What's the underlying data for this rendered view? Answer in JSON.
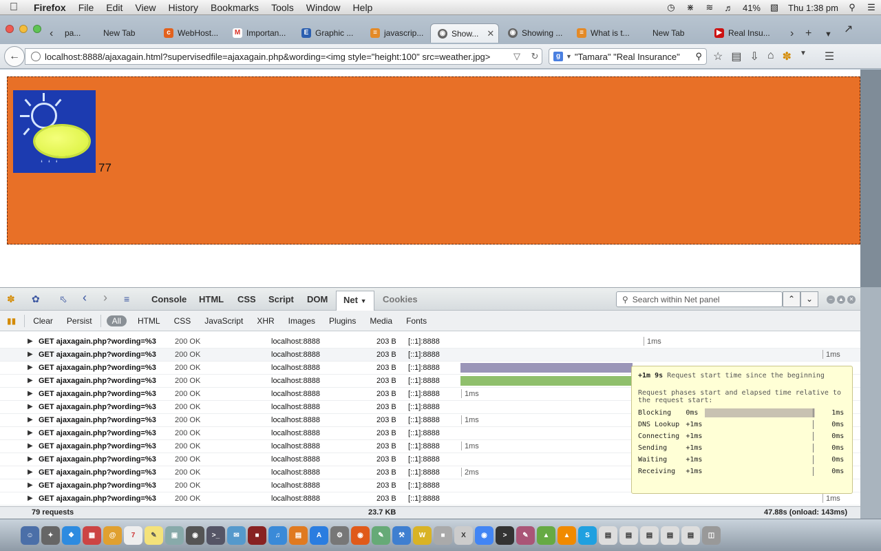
{
  "menubar": {
    "app_name": "Firefox",
    "menus": [
      "File",
      "Edit",
      "View",
      "History",
      "Bookmarks",
      "Tools",
      "Window",
      "Help"
    ],
    "battery": "41%",
    "clock": "Thu 1:38 pm"
  },
  "tabs": [
    {
      "label": "pa...",
      "icon": "generic-icon",
      "color": "#888888"
    },
    {
      "label": "New Tab",
      "icon": "none",
      "color": "#cccccc"
    },
    {
      "label": "WebHost...",
      "icon": "cpanel-icon",
      "color": "#e2611d"
    },
    {
      "label": "Importan...",
      "icon": "gmail-icon",
      "color": "#d93025"
    },
    {
      "label": "Graphic ...",
      "icon": "e-icon",
      "color": "#2b5fb0"
    },
    {
      "label": "javascrip...",
      "icon": "stackoverflow-icon",
      "color": "#e48a27"
    },
    {
      "label": "Show...",
      "icon": "globe-icon",
      "color": "#666666",
      "active": true
    },
    {
      "label": "Showing ...",
      "icon": "globe-icon",
      "color": "#666666"
    },
    {
      "label": "What is t...",
      "icon": "stackoverflow-icon",
      "color": "#e48a27"
    },
    {
      "label": "New Tab",
      "icon": "none",
      "color": "#cccccc"
    },
    {
      "label": "Real Insu...",
      "icon": "youtube-icon",
      "color": "#cc1111"
    }
  ],
  "address": {
    "url": "localhost:8888/ajaxagain.html?supervisedfile=ajaxagain.php&wording=<img style=\"height:100\" src=weather.jpg>"
  },
  "search": {
    "query": "\"Tamara\" \"Real Insurance\"",
    "engine_letter": "g"
  },
  "page": {
    "temperature": "77",
    "box_color": "#e87027"
  },
  "firebug": {
    "tabs": [
      "Console",
      "HTML",
      "CSS",
      "Script",
      "DOM",
      "Net",
      "Cookies"
    ],
    "active_tab": "Net",
    "search_placeholder": "Search within Net panel",
    "net_filters": [
      "Clear",
      "Persist",
      "All",
      "HTML",
      "CSS",
      "JavaScript",
      "XHR",
      "Images",
      "Plugins",
      "Media",
      "Fonts"
    ],
    "active_filter": "All"
  },
  "requests": [
    {
      "url": "GET ajaxagain.php?wording=%3",
      "status": "200 OK",
      "domain": "localhost:8888",
      "size": "203 B",
      "ip": "[::1]:8888",
      "time": "1ms"
    },
    {
      "url": "GET ajaxagain.php?wording=%3",
      "status": "200 OK",
      "domain": "localhost:8888",
      "size": "203 B",
      "ip": "[::1]:8888",
      "time": "1ms"
    },
    {
      "url": "GET ajaxagain.php?wording=%3",
      "status": "200 OK",
      "domain": "localhost:8888",
      "size": "203 B",
      "ip": "[::1]:8888",
      "time": ""
    },
    {
      "url": "GET ajaxagain.php?wording=%3",
      "status": "200 OK",
      "domain": "localhost:8888",
      "size": "203 B",
      "ip": "[::1]:8888",
      "time": ""
    },
    {
      "url": "GET ajaxagain.php?wording=%3",
      "status": "200 OK",
      "domain": "localhost:8888",
      "size": "203 B",
      "ip": "[::1]:8888",
      "time": "1ms"
    },
    {
      "url": "GET ajaxagain.php?wording=%3",
      "status": "200 OK",
      "domain": "localhost:8888",
      "size": "203 B",
      "ip": "[::1]:8888",
      "time": ""
    },
    {
      "url": "GET ajaxagain.php?wording=%3",
      "status": "200 OK",
      "domain": "localhost:8888",
      "size": "203 B",
      "ip": "[::1]:8888",
      "time": "1ms"
    },
    {
      "url": "GET ajaxagain.php?wording=%3",
      "status": "200 OK",
      "domain": "localhost:8888",
      "size": "203 B",
      "ip": "[::1]:8888",
      "time": ""
    },
    {
      "url": "GET ajaxagain.php?wording=%3",
      "status": "200 OK",
      "domain": "localhost:8888",
      "size": "203 B",
      "ip": "[::1]:8888",
      "time": "1ms"
    },
    {
      "url": "GET ajaxagain.php?wording=%3",
      "status": "200 OK",
      "domain": "localhost:8888",
      "size": "203 B",
      "ip": "[::1]:8888",
      "time": ""
    },
    {
      "url": "GET ajaxagain.php?wording=%3",
      "status": "200 OK",
      "domain": "localhost:8888",
      "size": "203 B",
      "ip": "[::1]:8888",
      "time": "2ms"
    },
    {
      "url": "GET ajaxagain.php?wording=%3",
      "status": "200 OK",
      "domain": "localhost:8888",
      "size": "203 B",
      "ip": "[::1]:8888",
      "time": ""
    },
    {
      "url": "GET ajaxagain.php?wording=%3",
      "status": "200 OK",
      "domain": "localhost:8888",
      "size": "203 B",
      "ip": "[::1]:8888",
      "time": "1ms"
    }
  ],
  "tooltip": {
    "start_time": "+1m 9s",
    "start_label": "Request start time since the beginning",
    "intro": "Request phases start and elapsed time relative to the request start:",
    "phases": [
      {
        "name": "Blocking",
        "start": "0ms",
        "elapsed": "1ms",
        "fraction": 1.0
      },
      {
        "name": "DNS Lookup",
        "start": "+1ms",
        "elapsed": "0ms",
        "fraction": 0
      },
      {
        "name": "Connecting",
        "start": "+1ms",
        "elapsed": "0ms",
        "fraction": 0
      },
      {
        "name": "Sending",
        "start": "+1ms",
        "elapsed": "0ms",
        "fraction": 0
      },
      {
        "name": "Waiting",
        "start": "+1ms",
        "elapsed": "0ms",
        "fraction": 0
      },
      {
        "name": "Receiving",
        "start": "+1ms",
        "elapsed": "0ms",
        "fraction": 0
      }
    ]
  },
  "summary": {
    "requests": "79 requests",
    "total_size": "23.7 KB",
    "total_time": "47.88s (onload: 143ms)"
  }
}
